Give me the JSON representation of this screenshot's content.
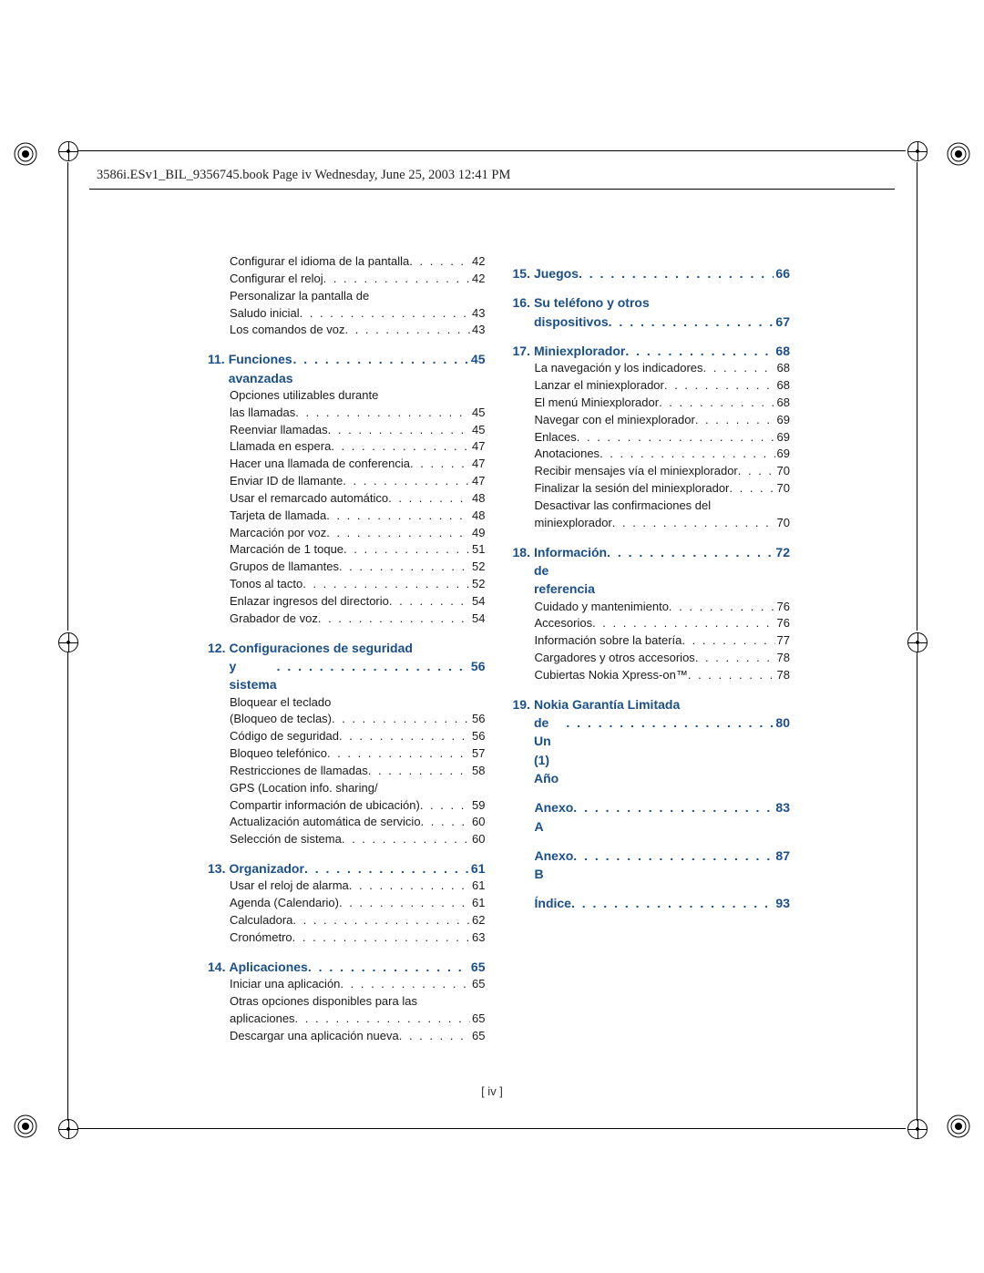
{
  "header": "3586i.ESv1_BIL_9356745.book  Page iv  Wednesday, June 25, 2003  12:41 PM",
  "page_number": "[  iv  ]",
  "dotstr": ". . . . . . . . . . . . . . . . . . . . . . . . . . . . . . . . . . . . . . . . . . . . . . . . . .",
  "left_top": [
    {
      "label": "Configurar el idioma de la pantalla",
      "page": "42"
    },
    {
      "label": "Configurar el reloj",
      "page": "42"
    },
    {
      "label": "Personalizar la pantalla de",
      "cont": true
    },
    {
      "label": "Saludo inicial",
      "page": "43",
      "indent": true,
      "noindent": true
    },
    {
      "label": "Los comandos de voz",
      "page": "43"
    }
  ],
  "ch11": {
    "num": "11.",
    "label": "Funciones avanzadas",
    "page": "45"
  },
  "s11": [
    {
      "label": "Opciones utilizables durante",
      "cont": true
    },
    {
      "label": "las llamadas",
      "page": "45",
      "noindent": true
    },
    {
      "label": "Reenviar llamadas",
      "page": "45"
    },
    {
      "label": "Llamada en espera",
      "page": "47"
    },
    {
      "label": "Hacer una llamada de conferencia",
      "page": "47"
    },
    {
      "label": "Enviar ID de llamante",
      "page": "47"
    },
    {
      "label": "Usar el remarcado automático",
      "page": "48"
    },
    {
      "label": "Tarjeta de llamada",
      "page": "48"
    },
    {
      "label": "Marcación por voz",
      "page": "49"
    },
    {
      "label": "Marcación de 1 toque",
      "page": "51"
    },
    {
      "label": "Grupos de llamantes",
      "page": "52"
    },
    {
      "label": "Tonos al tacto",
      "page": "52"
    },
    {
      "label": "Enlazar ingresos del directorio",
      "page": "54"
    },
    {
      "label": "Grabador de voz",
      "page": "54"
    }
  ],
  "ch12": {
    "num": "12.",
    "label1": "Configuraciones de seguridad",
    "label2": "y sistema",
    "page": "56"
  },
  "s12": [
    {
      "label": "Bloquear el teclado",
      "cont": true
    },
    {
      "label": "(Bloqueo de teclas)",
      "page": "56",
      "noindent": true
    },
    {
      "label": "Código de seguridad",
      "page": "56"
    },
    {
      "label": "Bloqueo telefónico",
      "page": "57"
    },
    {
      "label": "Restricciones de llamadas",
      "page": "58"
    },
    {
      "label": "GPS (Location info. sharing/",
      "cont": true
    },
    {
      "label": "Compartir información de ubicación)",
      "page": "59",
      "noindent": true
    },
    {
      "label": "Actualización automática de servicio",
      "page": "60"
    },
    {
      "label": "Selección de sistema",
      "page": "60"
    }
  ],
  "ch13": {
    "num": "13.",
    "label": "Organizador",
    "page": "61"
  },
  "s13": [
    {
      "label": "Usar el reloj de alarma",
      "page": "61"
    },
    {
      "label": "Agenda (Calendario)",
      "page": "61"
    },
    {
      "label": "Calculadora",
      "page": "62"
    },
    {
      "label": "Cronómetro",
      "page": "63"
    }
  ],
  "ch14": {
    "num": "14.",
    "label": "Aplicaciones",
    "page": "65"
  },
  "s14": [
    {
      "label": "Iniciar una aplicación",
      "page": "65"
    },
    {
      "label": "Otras opciones disponibles para las",
      "cont": true
    },
    {
      "label": "aplicaciones",
      "page": "65",
      "noindent": true
    },
    {
      "label": "Descargar una aplicación nueva",
      "page": "65"
    }
  ],
  "ch15": {
    "num": "15.",
    "label": "Juegos",
    "page": "66"
  },
  "ch16": {
    "num": "16.",
    "label1": "Su teléfono y otros",
    "label2": "dispositivos",
    "page": "67"
  },
  "ch17": {
    "num": "17.",
    "label": "Miniexplorador",
    "page": "68"
  },
  "s17": [
    {
      "label": "La navegación y los indicadores",
      "page": "68"
    },
    {
      "label": "Lanzar el miniexplorador",
      "page": "68"
    },
    {
      "label": "El menú Miniexplorador",
      "page": "68"
    },
    {
      "label": "Navegar con el miniexplorador",
      "page": "69"
    },
    {
      "label": "Enlaces",
      "page": "69"
    },
    {
      "label": "Anotaciones",
      "page": "69"
    },
    {
      "label": "Recibir mensajes vía el miniexplorador",
      "page": "70"
    },
    {
      "label": "Finalizar la sesión del miniexplorador",
      "page": "70"
    },
    {
      "label": "Desactivar las confirmaciones del",
      "cont": true
    },
    {
      "label": "miniexplorador",
      "page": "70",
      "noindent": true
    }
  ],
  "ch18": {
    "num": "18.",
    "label": "Información de referencia",
    "page": "72"
  },
  "s18": [
    {
      "label": "Cuidado y mantenimiento",
      "page": "76"
    },
    {
      "label": "Accesorios",
      "page": "76"
    },
    {
      "label": "Información sobre la batería",
      "page": "77"
    },
    {
      "label": "Cargadores y otros accesorios",
      "page": "78"
    },
    {
      "label": "Cubiertas Nokia Xpress-on™",
      "page": "78"
    }
  ],
  "ch19": {
    "num": "19.",
    "label1": "Nokia Garantía Limitada",
    "label2": "de Un (1) Año",
    "page": "80"
  },
  "anexoA": {
    "label": "Anexo A",
    "page": "83"
  },
  "anexoB": {
    "label": "Anexo B",
    "page": "87"
  },
  "indice": {
    "label": "Índice",
    "page": "93"
  }
}
